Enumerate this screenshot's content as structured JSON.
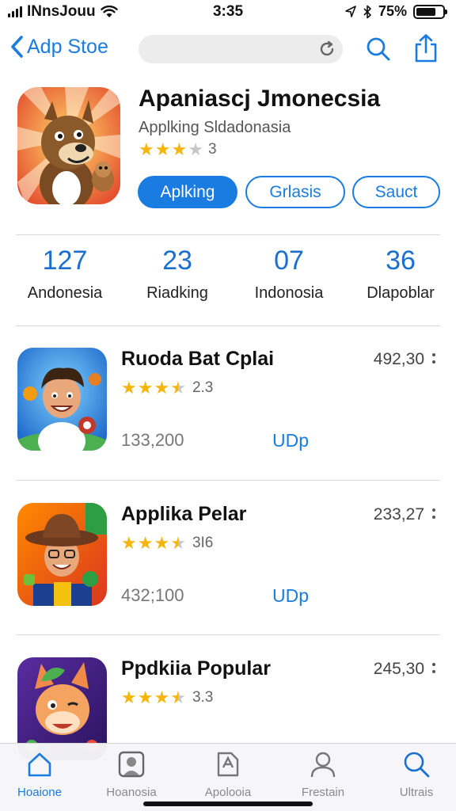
{
  "status_bar": {
    "carrier": "INnsJouu",
    "time": "3:35",
    "battery": "75%",
    "battery_level": 0.75
  },
  "nav": {
    "back_label": "Adp Stoe",
    "icons": [
      "chevron-left-icon",
      "reload-icon",
      "search-icon",
      "share-icon"
    ]
  },
  "app": {
    "title": "Apaniascj Jmonecsia",
    "subtitle": "Applking Sldadonasia",
    "rating": 3,
    "rating_text": "3",
    "buttons": {
      "primary": "Aplking",
      "secondary": "Grlasis",
      "tertiary": "Sauct"
    }
  },
  "stats": [
    {
      "value": "127",
      "label": "Andonesia"
    },
    {
      "value": "23",
      "label": "Riadking"
    },
    {
      "value": "07",
      "label": "Indonosia"
    },
    {
      "value": "36",
      "label": "Dlapoblar"
    }
  ],
  "apps": [
    {
      "name": "Ruoda Bat Cplai",
      "price": "492,30",
      "rating": 3.5,
      "rating_text": "2.3",
      "count": "133,200",
      "action": "UDp"
    },
    {
      "name": "Applika Pelar",
      "price": "233,27",
      "rating": 3.5,
      "rating_text": "3I6",
      "count": "432;100",
      "action": "UDp"
    },
    {
      "name": "Ppdkiia Popular",
      "price": "245,30",
      "rating": 3.5,
      "rating_text": "3.3",
      "count": "",
      "action": ""
    }
  ],
  "tabs": [
    {
      "label": "Hoaione",
      "icon": "home-icon",
      "active": true
    },
    {
      "label": "Hoanosia",
      "icon": "portrait-icon",
      "active": false
    },
    {
      "label": "Apolooia",
      "icon": "apps-icon",
      "active": false
    },
    {
      "label": "Frestain",
      "icon": "person-icon",
      "active": false
    },
    {
      "label": "Ultrais",
      "icon": "search-icon",
      "active": false
    }
  ],
  "colors": {
    "accent": "#1a7ce0",
    "star": "#f5b50a",
    "stat_value": "#1a6fcf"
  }
}
